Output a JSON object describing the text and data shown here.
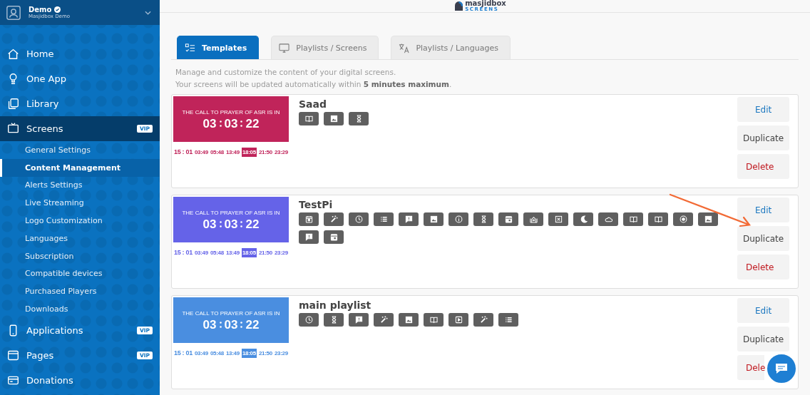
{
  "account": {
    "name": "Demo",
    "verified": true,
    "subtitle": "Masjidbox Demo"
  },
  "sidebar": {
    "items": [
      {
        "label": "Home",
        "selected": false
      },
      {
        "label": "One App",
        "selected": false
      },
      {
        "label": "Library",
        "selected": false
      },
      {
        "label": "Screens",
        "selected": true,
        "badge": "VIP",
        "expanded": true,
        "children": [
          {
            "label": "General Settings",
            "selected": false
          },
          {
            "label": "Content Management",
            "selected": true
          },
          {
            "label": "Alerts Settings",
            "selected": false
          },
          {
            "label": "Live Streaming",
            "selected": false
          },
          {
            "label": "Logo Customization",
            "selected": false
          },
          {
            "label": "Languages",
            "selected": false
          },
          {
            "label": "Subscription",
            "selected": false
          },
          {
            "label": "Compatible devices",
            "selected": false
          },
          {
            "label": "Purchased Players",
            "selected": false
          },
          {
            "label": "Downloads",
            "selected": false
          }
        ]
      },
      {
        "label": "Applications",
        "selected": false,
        "badge": "VIP"
      },
      {
        "label": "Pages",
        "selected": false,
        "badge": "VIP"
      },
      {
        "label": "Donations",
        "selected": false
      }
    ]
  },
  "logo": {
    "name": "masjidbox",
    "subtitle": "SCREENS"
  },
  "tabs": [
    {
      "label": "Templates",
      "selected": true
    },
    {
      "label": "Playlists / Screens",
      "selected": false
    },
    {
      "label": "Playlists / Languages",
      "selected": false
    }
  ],
  "description": [
    "Manage and customize the content of your digital screens.",
    "Your screens will be updated automatically within **5 minutes maximum**."
  ],
  "templates": [
    {
      "name": "Saad",
      "color": "#c0245a",
      "preview": {
        "headline": "THE CALL TO PRAYER OF ASR IS IN",
        "countdown": [
          "03",
          "03",
          "22"
        ],
        "clock": "15 : 01",
        "times": [
          {
            "value": "03:49",
            "selected": false
          },
          {
            "value": "05:48",
            "selected": false
          },
          {
            "value": "13:49",
            "selected": false
          },
          {
            "value": "18:05",
            "selected": true
          },
          {
            "value": "21:50",
            "selected": false
          },
          {
            "value": "23:29",
            "selected": false
          }
        ]
      },
      "icons": [
        {
          "kind": "book"
        },
        {
          "kind": "image"
        },
        {
          "kind": "hourglass"
        }
      ],
      "actions": [
        "Edit",
        "Duplicate",
        "Delete"
      ]
    },
    {
      "name": "TestPi",
      "color": "#6563e8",
      "preview": {
        "headline": "THE CALL TO PRAYER OF ASR IS IN",
        "countdown": [
          "03",
          "03",
          "22"
        ],
        "clock": "15 : 01",
        "times": [
          {
            "value": "03:49",
            "selected": false
          },
          {
            "value": "05:48",
            "selected": false
          },
          {
            "value": "13:49",
            "selected": false
          },
          {
            "value": "18:05",
            "selected": true
          },
          {
            "value": "21:50",
            "selected": false
          },
          {
            "value": "23:29",
            "selected": false
          }
        ]
      },
      "icons": [
        {
          "kind": "calendar"
        },
        {
          "kind": "magic"
        },
        {
          "kind": "clock"
        },
        {
          "kind": "list"
        },
        {
          "kind": "alert"
        },
        {
          "kind": "image"
        },
        {
          "kind": "info"
        },
        {
          "kind": "hourglass"
        },
        {
          "kind": "event"
        },
        {
          "kind": "mosque"
        },
        {
          "kind": "close"
        },
        {
          "kind": "moon"
        },
        {
          "kind": "cloud"
        },
        {
          "kind": "book"
        },
        {
          "kind": "book"
        },
        {
          "kind": "target"
        },
        {
          "kind": "image"
        },
        {
          "kind": "alert"
        },
        {
          "kind": "event"
        }
      ],
      "actions": [
        "Edit",
        "Duplicate",
        "Delete"
      ]
    },
    {
      "name": "main playlist",
      "color": "#4a8ee0",
      "preview": {
        "headline": "THE CALL TO PRAYER OF ASR IS IN",
        "countdown": [
          "03",
          "03",
          "22"
        ],
        "clock": "15 : 01",
        "times": [
          {
            "value": "03:49",
            "selected": false
          },
          {
            "value": "05:48",
            "selected": false
          },
          {
            "value": "13:49",
            "selected": false
          },
          {
            "value": "18:05",
            "selected": true
          },
          {
            "value": "21:50",
            "selected": false
          },
          {
            "value": "23:29",
            "selected": false
          }
        ]
      },
      "icons": [
        {
          "kind": "clock"
        },
        {
          "kind": "hourglass"
        },
        {
          "kind": "alert"
        },
        {
          "kind": "magic"
        },
        {
          "kind": "image"
        },
        {
          "kind": "book"
        },
        {
          "kind": "video"
        },
        {
          "kind": "magic"
        },
        {
          "kind": "list"
        }
      ],
      "actions": [
        "Edit",
        "Duplicate",
        "Dele"
      ]
    }
  ]
}
